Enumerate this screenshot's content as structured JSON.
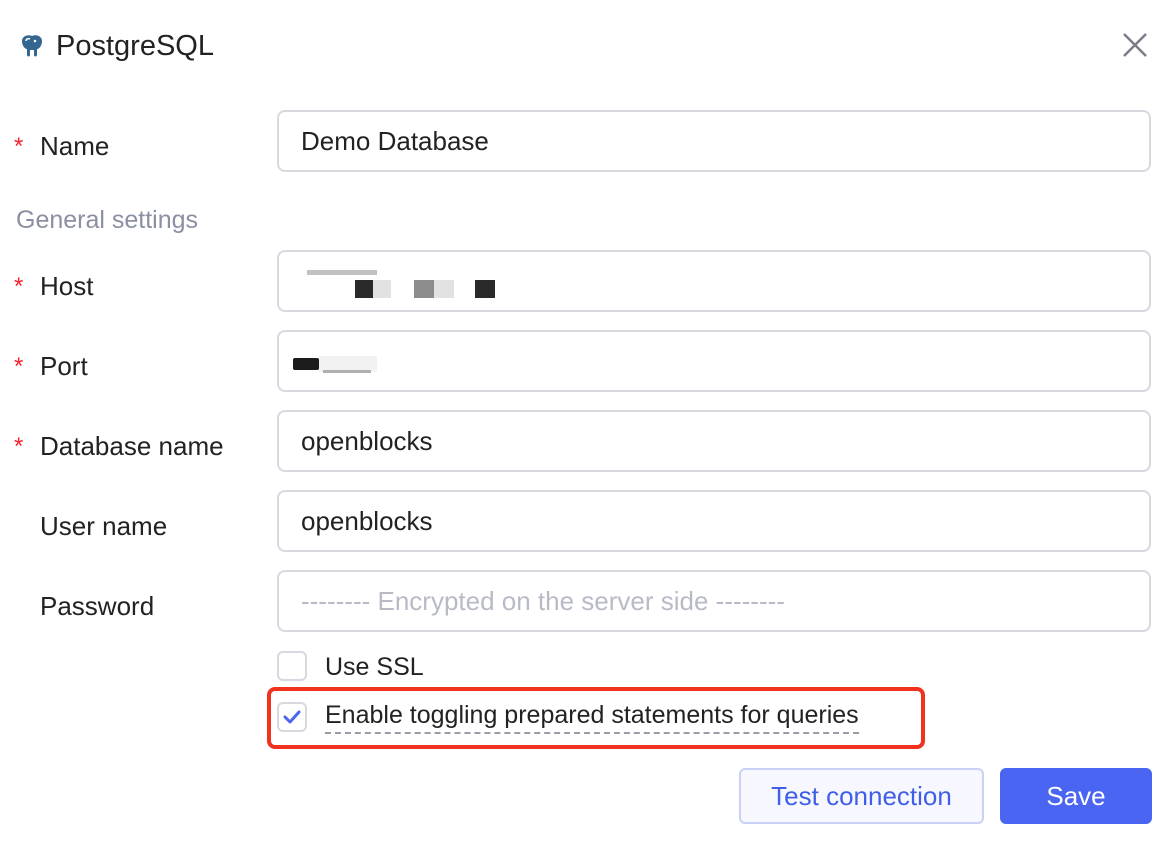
{
  "dialog": {
    "title": "PostgreSQL",
    "icon": "postgresql-elephant-icon",
    "close_icon": "close-icon"
  },
  "form": {
    "name": {
      "label": "Name",
      "required": "*",
      "value": "Demo Database"
    },
    "section_title": "General settings",
    "host": {
      "label": "Host",
      "required": "*"
    },
    "port": {
      "label": "Port",
      "required": "*"
    },
    "database_name": {
      "label": "Database name",
      "required": "*",
      "value": "openblocks"
    },
    "user_name": {
      "label": "User name",
      "value": "openblocks"
    },
    "password": {
      "label": "Password",
      "placeholder": "-------- Encrypted on the server side --------"
    },
    "use_ssl": {
      "label": "Use SSL",
      "checked": false
    },
    "prepared_statements": {
      "label": "Enable toggling prepared statements for queries",
      "checked": true
    }
  },
  "buttons": {
    "test_connection": "Test connection",
    "save": "Save"
  },
  "colors": {
    "primary": "#4965f2",
    "required": "#f5222d",
    "highlight": "#f0321e",
    "section": "#8b8fa3"
  }
}
